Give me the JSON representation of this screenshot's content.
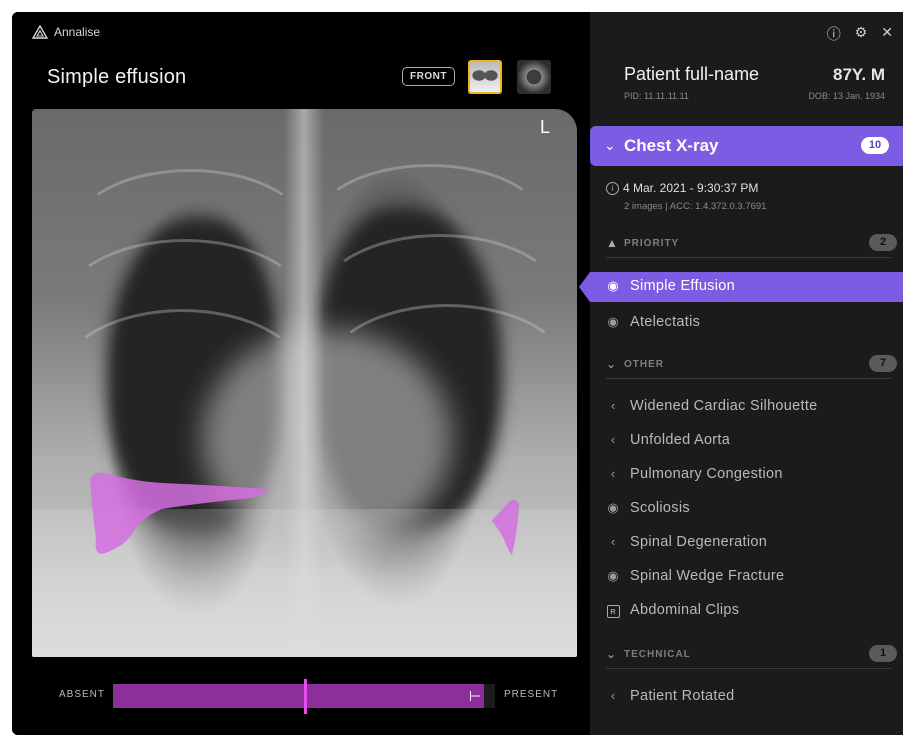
{
  "app": {
    "brand": "Annalise"
  },
  "viewer": {
    "finding_title": "Simple effusion",
    "view_badge": "FRONT",
    "side_marker": "L",
    "slider": {
      "left_label": "ABSENT",
      "right_label": "PRESENT",
      "value_fraction": 0.97,
      "threshold_fraction": 0.5
    }
  },
  "patient": {
    "name": "Patient full-name",
    "age_sex": "87Y. M",
    "pid": "PID: 11.11.11.11",
    "dob": "DOB: 13 Jan. 1934"
  },
  "study": {
    "title": "Chest X-ray",
    "count": "10",
    "datetime": "4 Mar. 2021 - 9:30:37 PM",
    "meta": "2 images  |  ACC: 1.4.372.0.3.7691"
  },
  "sections": {
    "priority": {
      "label": "PRIORITY",
      "count": "2"
    },
    "other": {
      "label": "OTHER",
      "count": "7"
    },
    "technical": {
      "label": "TECHNICAL",
      "count": "1"
    }
  },
  "findings": {
    "priority": [
      "Simple Effusion",
      "Atelectatis"
    ],
    "other": [
      "Widened Cardiac Silhouette",
      "Unfolded Aorta",
      "Pulmonary Congestion",
      "Scoliosis",
      "Spinal Degeneration",
      "Spinal Wedge Fracture",
      "Abdominal Clips"
    ],
    "technical": [
      "Patient Rotated"
    ]
  },
  "colors": {
    "accent": "#7d5ce4",
    "overlay": "#d36ee0",
    "thumb_selected": "#f2b520",
    "slider_fill": "#8d2f9a"
  }
}
